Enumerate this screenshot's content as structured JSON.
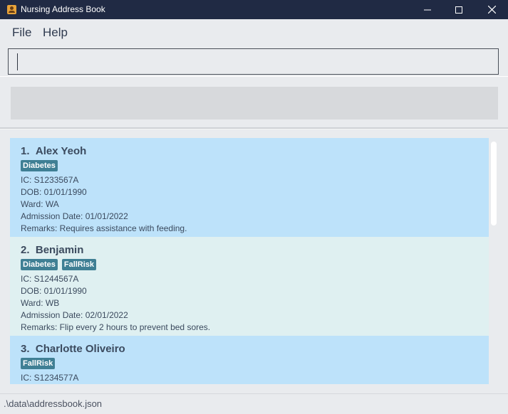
{
  "window": {
    "title": "Nursing Address Book",
    "icons": {
      "app": "address-book-icon",
      "minimize": "minimize-icon",
      "maximize": "maximize-icon",
      "close": "close-icon"
    }
  },
  "menu": {
    "file": "File",
    "help": "Help"
  },
  "command_box": {
    "value": ""
  },
  "result_display": {
    "text": ""
  },
  "patients": [
    {
      "index": "1.",
      "name": "Alex Yeoh",
      "tags": [
        "Diabetes"
      ],
      "ic": "IC: S1233567A",
      "dob": "DOB: 01/01/1990",
      "ward": "Ward: WA",
      "admission": "Admission Date: 01/01/2022",
      "remarks": "Remarks: Requires assistance with feeding."
    },
    {
      "index": "2.",
      "name": "Benjamin",
      "tags": [
        "Diabetes",
        "FallRisk"
      ],
      "ic": "IC: S1244567A",
      "dob": "DOB: 01/01/1990",
      "ward": "Ward: WB",
      "admission": "Admission Date: 02/01/2022",
      "remarks": "Remarks: Flip every 2 hours to prevent bed sores."
    },
    {
      "index": "3.",
      "name": "Charlotte Oliveiro",
      "tags": [
        "FallRisk"
      ],
      "ic": "IC: S1234577A",
      "dob": "",
      "ward": "",
      "admission": "",
      "remarks": ""
    }
  ],
  "status_bar": {
    "path": ".\\data\\addressbook.json"
  },
  "colors": {
    "titlebar": "#202a44",
    "card_odd": "#bde2fa",
    "card_even": "#dff0f1",
    "tag": "#3f7f94"
  }
}
